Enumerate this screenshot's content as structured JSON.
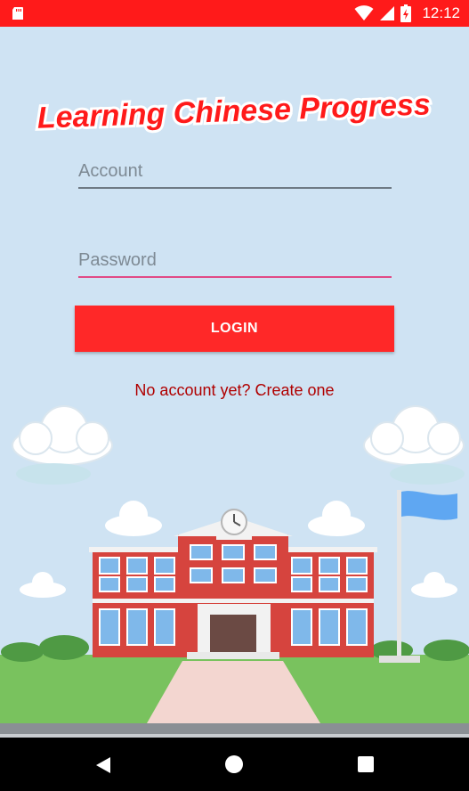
{
  "status_bar": {
    "time": "12:12",
    "icons": [
      "sd-card-icon",
      "wifi-icon",
      "signal-icon",
      "battery-charging-icon"
    ]
  },
  "app": {
    "title": "Learning Chinese Progress"
  },
  "form": {
    "account_placeholder": "Account",
    "account_value": "",
    "password_placeholder": "Password",
    "password_value": "",
    "login_label": "LOGIN",
    "create_account_text": "No account yet? Create one"
  },
  "colors": {
    "status_bar": "#ff1a1a",
    "background": "#cfe3f3",
    "login_button": "#ff2828",
    "link_text": "#b00000",
    "title_text": "#ff1a1a",
    "focused_underline": "#e14a86"
  },
  "nav_bar": {
    "icons": [
      "back-icon",
      "home-icon",
      "recents-icon"
    ]
  }
}
